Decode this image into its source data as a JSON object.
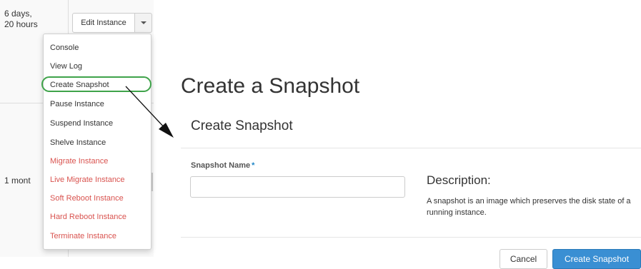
{
  "table": {
    "row1_age": "6 days,\n20 hours",
    "row2_age": "1 mont"
  },
  "actions": {
    "edit_label": "Edit Instance",
    "caret_icon": "caret-down-icon",
    "menu_items": [
      {
        "label": "Console",
        "style": "normal"
      },
      {
        "label": "View Log",
        "style": "normal"
      },
      {
        "label": "Create Snapshot",
        "style": "normal",
        "highlighted": true
      },
      {
        "label": "Pause Instance",
        "style": "normal"
      },
      {
        "label": "Suspend Instance",
        "style": "normal"
      },
      {
        "label": "Shelve Instance",
        "style": "normal"
      },
      {
        "label": "Migrate Instance",
        "style": "danger"
      },
      {
        "label": "Live Migrate Instance",
        "style": "danger"
      },
      {
        "label": "Soft Reboot Instance",
        "style": "danger"
      },
      {
        "label": "Hard Reboot Instance",
        "style": "danger"
      },
      {
        "label": "Terminate Instance",
        "style": "danger"
      }
    ]
  },
  "page": {
    "title": "Create a Snapshot"
  },
  "modal": {
    "title": "Create Snapshot",
    "field_label": "Snapshot Name",
    "required_mark": "*",
    "input_value": "",
    "description_title": "Description:",
    "description_text": "A snapshot is an image which preserves the disk state of a running instance.",
    "cancel_label": "Cancel",
    "submit_label": "Create Snapshot"
  },
  "colors": {
    "danger": "#d9534f",
    "primary": "#3a8fd3",
    "highlight": "#3fa34a",
    "required": "#1c84c6"
  }
}
